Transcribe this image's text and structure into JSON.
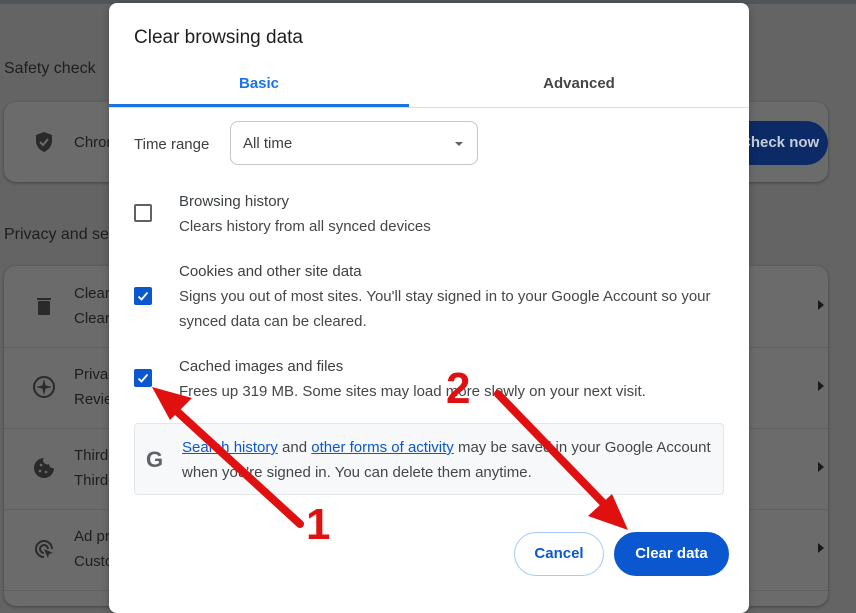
{
  "background_page": {
    "safety_check": {
      "heading": "Safety check",
      "item_text": "Chrome helps keep you safe from data breaches, bad extensions, and more",
      "check_now_label": "Check now"
    },
    "privacy": {
      "heading": "Privacy and security",
      "rows": [
        {
          "icon": "trash-icon",
          "title": "Clear browsing data",
          "subtitle": "Clear history, cookies, cache, and more"
        },
        {
          "icon": "compass-icon",
          "title": "Privacy Guide",
          "subtitle": "Review key privacy and security controls"
        },
        {
          "icon": "cookie-icon",
          "title": "Third-party cookies",
          "subtitle": "Third-party cookies are blocked in Incognito mode"
        },
        {
          "icon": "ad-privacy-icon",
          "title": "Ad privacy",
          "subtitle": "Customize the info used by sites to show you ads"
        }
      ]
    }
  },
  "dialog": {
    "title": "Clear browsing data",
    "tabs": [
      {
        "label": "Basic",
        "active": true
      },
      {
        "label": "Advanced",
        "active": false
      }
    ],
    "time_range": {
      "label": "Time range",
      "selected": "All time"
    },
    "options": [
      {
        "title": "Browsing history",
        "description": "Clears history from all synced devices",
        "checked": false
      },
      {
        "title": "Cookies and other site data",
        "description": "Signs you out of most sites. You'll stay signed in to your Google Account so your synced data can be cleared.",
        "checked": true
      },
      {
        "title": "Cached images and files",
        "description": "Frees up 319 MB. Some sites may load more slowly on your next visit.",
        "checked": true
      }
    ],
    "info": {
      "link1": "Search history",
      "and": " and ",
      "link2": "other forms of activity",
      "rest": " may be saved in your Google Account when you're signed in. You can delete them anytime."
    },
    "buttons": {
      "cancel": "Cancel",
      "clear": "Clear data"
    }
  },
  "annotations": {
    "step1": "1",
    "step2": "2",
    "color": "#e01010"
  }
}
